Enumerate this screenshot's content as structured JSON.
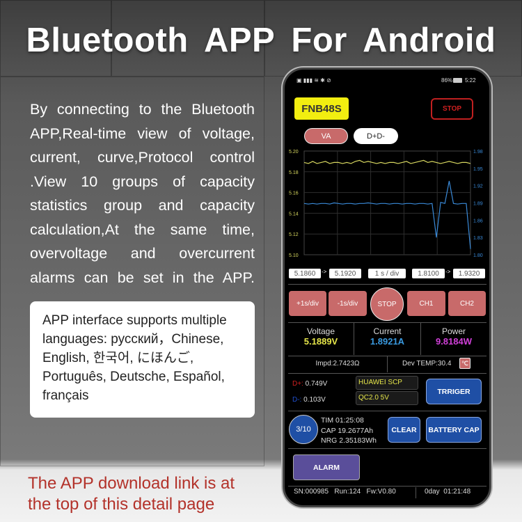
{
  "headline": "Bluetooth APP For Android",
  "description": "By connecting to the Bluetooth APP,Real-time view of voltage, current, curve,Protocol control .View 10 groups of capacity statistics group and capacity calculation,At the same time, overvoltage and overcurrent alarms can be set in the APP.",
  "languages_note": "APP interface supports multiple languages: русский，Chinese, English, 한국어, にほんご, Português, Deutsche, Español, français",
  "footnote": "The APP download link is at the top of this detail page",
  "phone": {
    "status": {
      "battery": "86%",
      "time": "5:22"
    },
    "device_name": "FNB48S",
    "stop_label": "STOP",
    "tabs": [
      "VA",
      "D+D-"
    ],
    "chart_data": {
      "type": "line",
      "y_left_ticks": [
        "5.20",
        "5.18",
        "5.16",
        "5.14",
        "5.12",
        "5.10"
      ],
      "y_right_ticks": [
        "1.98",
        "1.95",
        "1.92",
        "1.89",
        "1.86",
        "1.83",
        "1.80"
      ],
      "ylim_left": [
        5.1,
        5.2
      ],
      "ylim_right": [
        1.8,
        1.98
      ],
      "grid": true,
      "series": [
        {
          "axis": "left",
          "color": "#d8d860",
          "values": [
            5.189,
            5.188,
            5.19,
            5.188,
            5.189,
            5.19,
            5.188,
            5.189,
            5.189,
            5.188,
            5.189,
            5.188,
            5.19,
            5.191,
            5.189,
            5.19,
            5.189,
            5.188,
            5.189,
            5.188,
            5.189,
            5.189,
            5.188,
            5.189,
            5.19,
            5.188,
            5.189,
            5.19,
            5.191,
            5.189,
            5.19,
            5.189,
            5.188,
            5.189,
            5.19,
            5.189,
            5.188,
            5.189,
            5.189,
            5.188
          ]
        },
        {
          "axis": "right",
          "color": "#3a8ad8",
          "values": [
            1.889,
            1.888,
            1.889,
            1.888,
            1.889,
            1.889,
            1.888,
            1.89,
            1.889,
            1.888,
            1.889,
            1.889,
            1.888,
            1.889,
            1.889,
            1.89,
            1.889,
            1.888,
            1.889,
            1.889,
            1.888,
            1.889,
            1.889,
            1.888,
            1.889,
            1.889,
            1.888,
            1.889,
            1.889,
            1.888,
            1.889,
            1.83,
            1.891,
            1.889,
            1.928,
            1.889,
            1.888,
            1.889,
            1.889,
            1.81
          ]
        }
      ]
    },
    "readouts": [
      "5.1860",
      "5.1920",
      "1 s / div",
      "1.8100",
      "1.9320"
    ],
    "arrow": "->",
    "controls": [
      "+1s/div",
      "-1s/div",
      "STOP",
      "CH1",
      "CH2"
    ],
    "metrics": [
      {
        "label": "Voltage",
        "value": "5.1889V",
        "color": "#e6e64a"
      },
      {
        "label": "Current",
        "value": "1.8921A",
        "color": "#3a9ae0"
      },
      {
        "label": "Power",
        "value": "9.8184W",
        "color": "#d040d8"
      }
    ],
    "impedance": "Impd:2.7423Ω",
    "dev_temp": "Dev TEMP:30.4",
    "temp_unit": "℃",
    "dplus_label": "D+:",
    "dplus_value": "0.749V",
    "dminus_label": "D-:",
    "dminus_value": "0.103V",
    "protocols": [
      "HUAWEI SCP",
      "QC2.0 5V"
    ],
    "trigger_label": "TRRIGER",
    "group": "3/10",
    "tim": "TIM 01:25:08",
    "cap": "CAP 19.2677Ah",
    "nrg": "NRG 2.35183Wh",
    "clear_label": "CLEAR",
    "battery_cap_label": "BATTERY CAP",
    "alarm_label": "ALARM",
    "footer": {
      "sn": "SN:000985",
      "run": "Run:124",
      "fw": "Fw:V0.80",
      "uptime": "0day  01:21:48"
    }
  }
}
